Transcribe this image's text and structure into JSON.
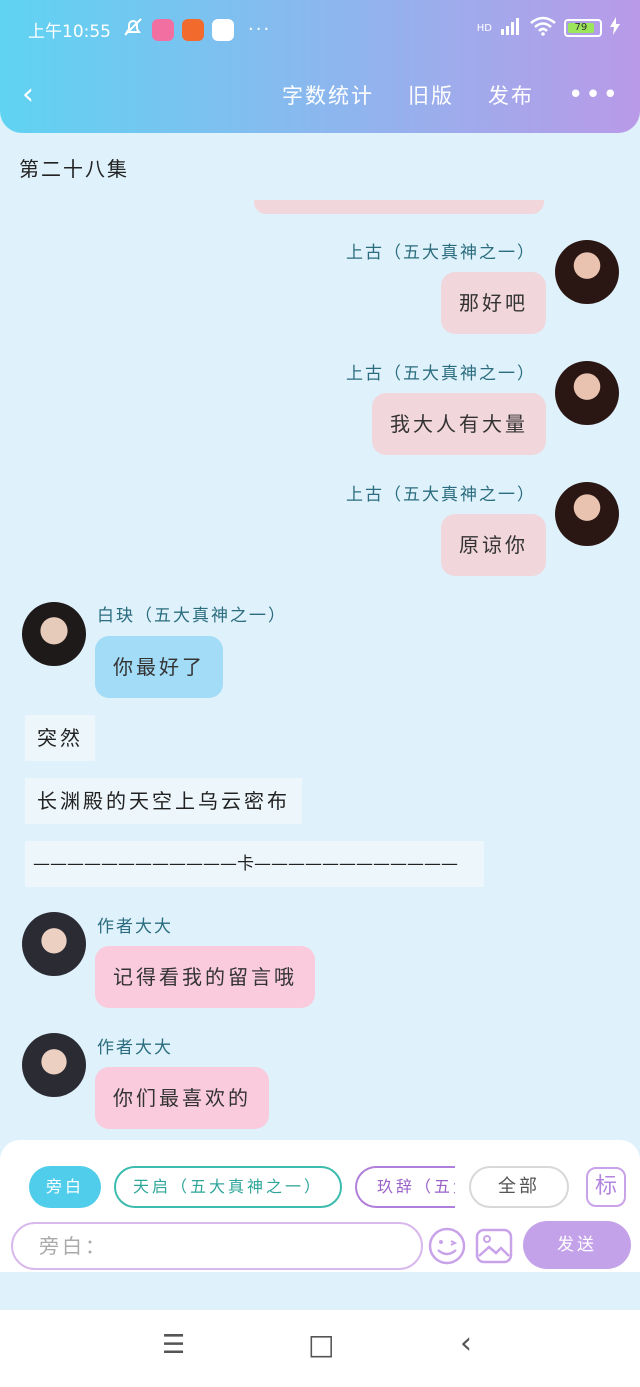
{
  "status_bar": {
    "time": "上午10:55",
    "more": "···",
    "network": "HD",
    "battery": "79"
  },
  "header": {
    "back": "‹",
    "word_count": "字数统计",
    "old_version": "旧版",
    "publish": "发布",
    "more": "•••"
  },
  "chapter_title": "第二十八集",
  "messages": [
    {
      "speaker": "上古（五大真神之一）",
      "text": "那好吧"
    },
    {
      "speaker": "上古（五大真神之一）",
      "text": "我大人有大量"
    },
    {
      "speaker": "上古（五大真神之一）",
      "text": "原谅你"
    },
    {
      "speaker": "白玦（五大真神之一）",
      "text": "你最好了"
    },
    {
      "narration": "突然"
    },
    {
      "narration": "长渊殿的天空上乌云密布"
    },
    {
      "narration": "————————————卡————————————"
    },
    {
      "speaker": "作者大大",
      "text": "记得看我的留言哦"
    },
    {
      "speaker": "作者大大",
      "text": "你们最喜欢的"
    }
  ],
  "roles": [
    "旁白",
    "天启（五大真神之一）",
    "玖辞（五大真神之一）",
    "全部"
  ],
  "biao": "标",
  "input": {
    "placeholder": "旁白："
  },
  "send_label": "发送",
  "system_nav": {
    "menu": "☰",
    "home": "□",
    "back": "‹"
  },
  "colors": {
    "accent_send": "#c4a2ea",
    "bubble_self": "#f1d6dc",
    "bubble_other": "#a3dcf6",
    "bubble_author": "#f9cbdc",
    "chip_active": "#4fcdeb"
  }
}
